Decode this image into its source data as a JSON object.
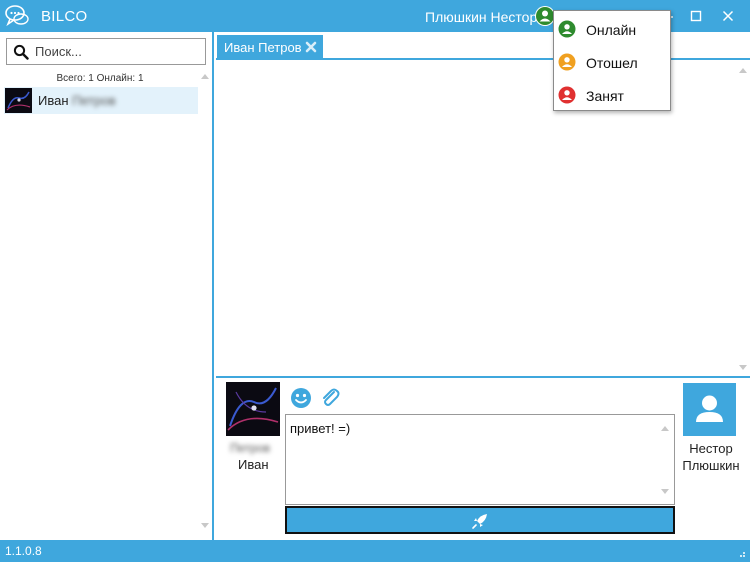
{
  "app": {
    "title": "BILCO",
    "version": "1.1.0.8",
    "accent": "#3fa7dd"
  },
  "header": {
    "user_name": "Плюшкин Нестор"
  },
  "search": {
    "placeholder": "Поиск..."
  },
  "contacts": {
    "summary": "Всего: 1 Онлайн: 1",
    "items": [
      {
        "first_name": "Иван",
        "last_name": "Петров"
      }
    ]
  },
  "tabs": [
    {
      "label": "Иван Петров"
    }
  ],
  "compose": {
    "peer_first_name": "Иван",
    "peer_last_name": "Петров",
    "message": "привет! =)",
    "self_first_name": "Нестор",
    "self_last_name": "Плюшкин"
  },
  "status_menu": [
    {
      "label": "Онлайн",
      "color": "#2e8b2e",
      "icon": "user-circle-icon"
    },
    {
      "label": "Отошел",
      "color": "#f0a020",
      "icon": "user-circle-icon"
    },
    {
      "label": "Занят",
      "color": "#e03030",
      "icon": "user-circle-icon"
    }
  ]
}
